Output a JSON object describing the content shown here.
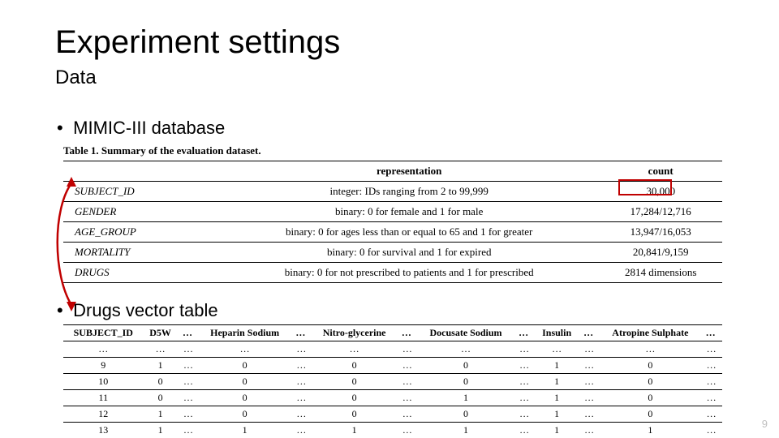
{
  "title": "Experiment settings",
  "subtitle": "Data",
  "bullets": {
    "b1": "MIMIC-III database",
    "b2": "Drugs vector table"
  },
  "table1": {
    "caption": "Table 1. Summary of the evaluation dataset.",
    "headers": {
      "h0": "",
      "h1": "representation",
      "h2": "count"
    },
    "rows": [
      {
        "name": "SUBJECT_ID",
        "rep": "integer: IDs ranging from 2 to 99,999",
        "count": "30,000"
      },
      {
        "name": "GENDER",
        "rep": "binary: 0 for female and 1 for male",
        "count": "17,284/12,716"
      },
      {
        "name": "AGE_GROUP",
        "rep": "binary: 0 for ages less than or equal to 65 and 1 for greater",
        "count": "13,947/16,053"
      },
      {
        "name": "MORTALITY",
        "rep": "binary: 0 for survival and 1 for expired",
        "count": "20,841/9,159"
      },
      {
        "name": "DRUGS",
        "rep": "binary: 0 for not prescribed to patients and 1 for prescribed",
        "count": "2814 dimensions"
      }
    ]
  },
  "table2": {
    "headers": [
      "SUBJECT_ID",
      "D5W",
      "…",
      "Heparin Sodium",
      "…",
      "Nitro-glycerine",
      "…",
      "Docusate Sodium",
      "…",
      "Insulin",
      "…",
      "Atropine Sulphate",
      "…"
    ],
    "rows": [
      [
        "…",
        "…",
        "…",
        "…",
        "…",
        "…",
        "…",
        "…",
        "…",
        "…",
        "…",
        "…",
        "…"
      ],
      [
        "9",
        "1",
        "…",
        "0",
        "…",
        "0",
        "…",
        "0",
        "…",
        "1",
        "…",
        "0",
        "…"
      ],
      [
        "10",
        "0",
        "…",
        "0",
        "…",
        "0",
        "…",
        "0",
        "…",
        "1",
        "…",
        "0",
        "…"
      ],
      [
        "11",
        "0",
        "…",
        "0",
        "…",
        "0",
        "…",
        "1",
        "…",
        "1",
        "…",
        "0",
        "…"
      ],
      [
        "12",
        "1",
        "…",
        "0",
        "…",
        "0",
        "…",
        "0",
        "…",
        "1",
        "…",
        "0",
        "…"
      ],
      [
        "13",
        "1",
        "…",
        "1",
        "…",
        "1",
        "…",
        "1",
        "…",
        "1",
        "…",
        "1",
        "…"
      ]
    ]
  },
  "page_number": "9",
  "chart_data": [
    {
      "type": "table",
      "title": "Table 1. Summary of the evaluation dataset.",
      "columns": [
        "",
        "representation",
        "count"
      ],
      "rows": [
        [
          "SUBJECT_ID",
          "integer: IDs ranging from 2 to 99,999",
          "30,000"
        ],
        [
          "GENDER",
          "binary: 0 for female and 1 for male",
          "17,284/12,716"
        ],
        [
          "AGE_GROUP",
          "binary: 0 for ages less than or equal to 65 and 1 for greater",
          "13,947/16,053"
        ],
        [
          "MORTALITY",
          "binary: 0 for survival and 1 for expired",
          "20,841/9,159"
        ],
        [
          "DRUGS",
          "binary: 0 for not prescribed to patients and 1 for prescribed",
          "2814 dimensions"
        ]
      ]
    },
    {
      "type": "table",
      "title": "Drugs vector table",
      "columns": [
        "SUBJECT_ID",
        "D5W",
        "…",
        "Heparin Sodium",
        "…",
        "Nitro-glycerine",
        "…",
        "Docusate Sodium",
        "…",
        "Insulin",
        "…",
        "Atropine Sulphate",
        "…"
      ],
      "rows": [
        [
          "…",
          "…",
          "…",
          "…",
          "…",
          "…",
          "…",
          "…",
          "…",
          "…",
          "…",
          "…",
          "…"
        ],
        [
          "9",
          "1",
          "…",
          "0",
          "…",
          "0",
          "…",
          "0",
          "…",
          "1",
          "…",
          "0",
          "…"
        ],
        [
          "10",
          "0",
          "…",
          "0",
          "…",
          "0",
          "…",
          "0",
          "…",
          "1",
          "…",
          "0",
          "…"
        ],
        [
          "11",
          "0",
          "…",
          "0",
          "…",
          "0",
          "…",
          "1",
          "…",
          "1",
          "…",
          "0",
          "…"
        ],
        [
          "12",
          "1",
          "…",
          "0",
          "…",
          "0",
          "…",
          "0",
          "…",
          "1",
          "…",
          "0",
          "…"
        ],
        [
          "13",
          "1",
          "…",
          "1",
          "…",
          "1",
          "…",
          "1",
          "…",
          "1",
          "…",
          "1",
          "…"
        ]
      ]
    }
  ]
}
